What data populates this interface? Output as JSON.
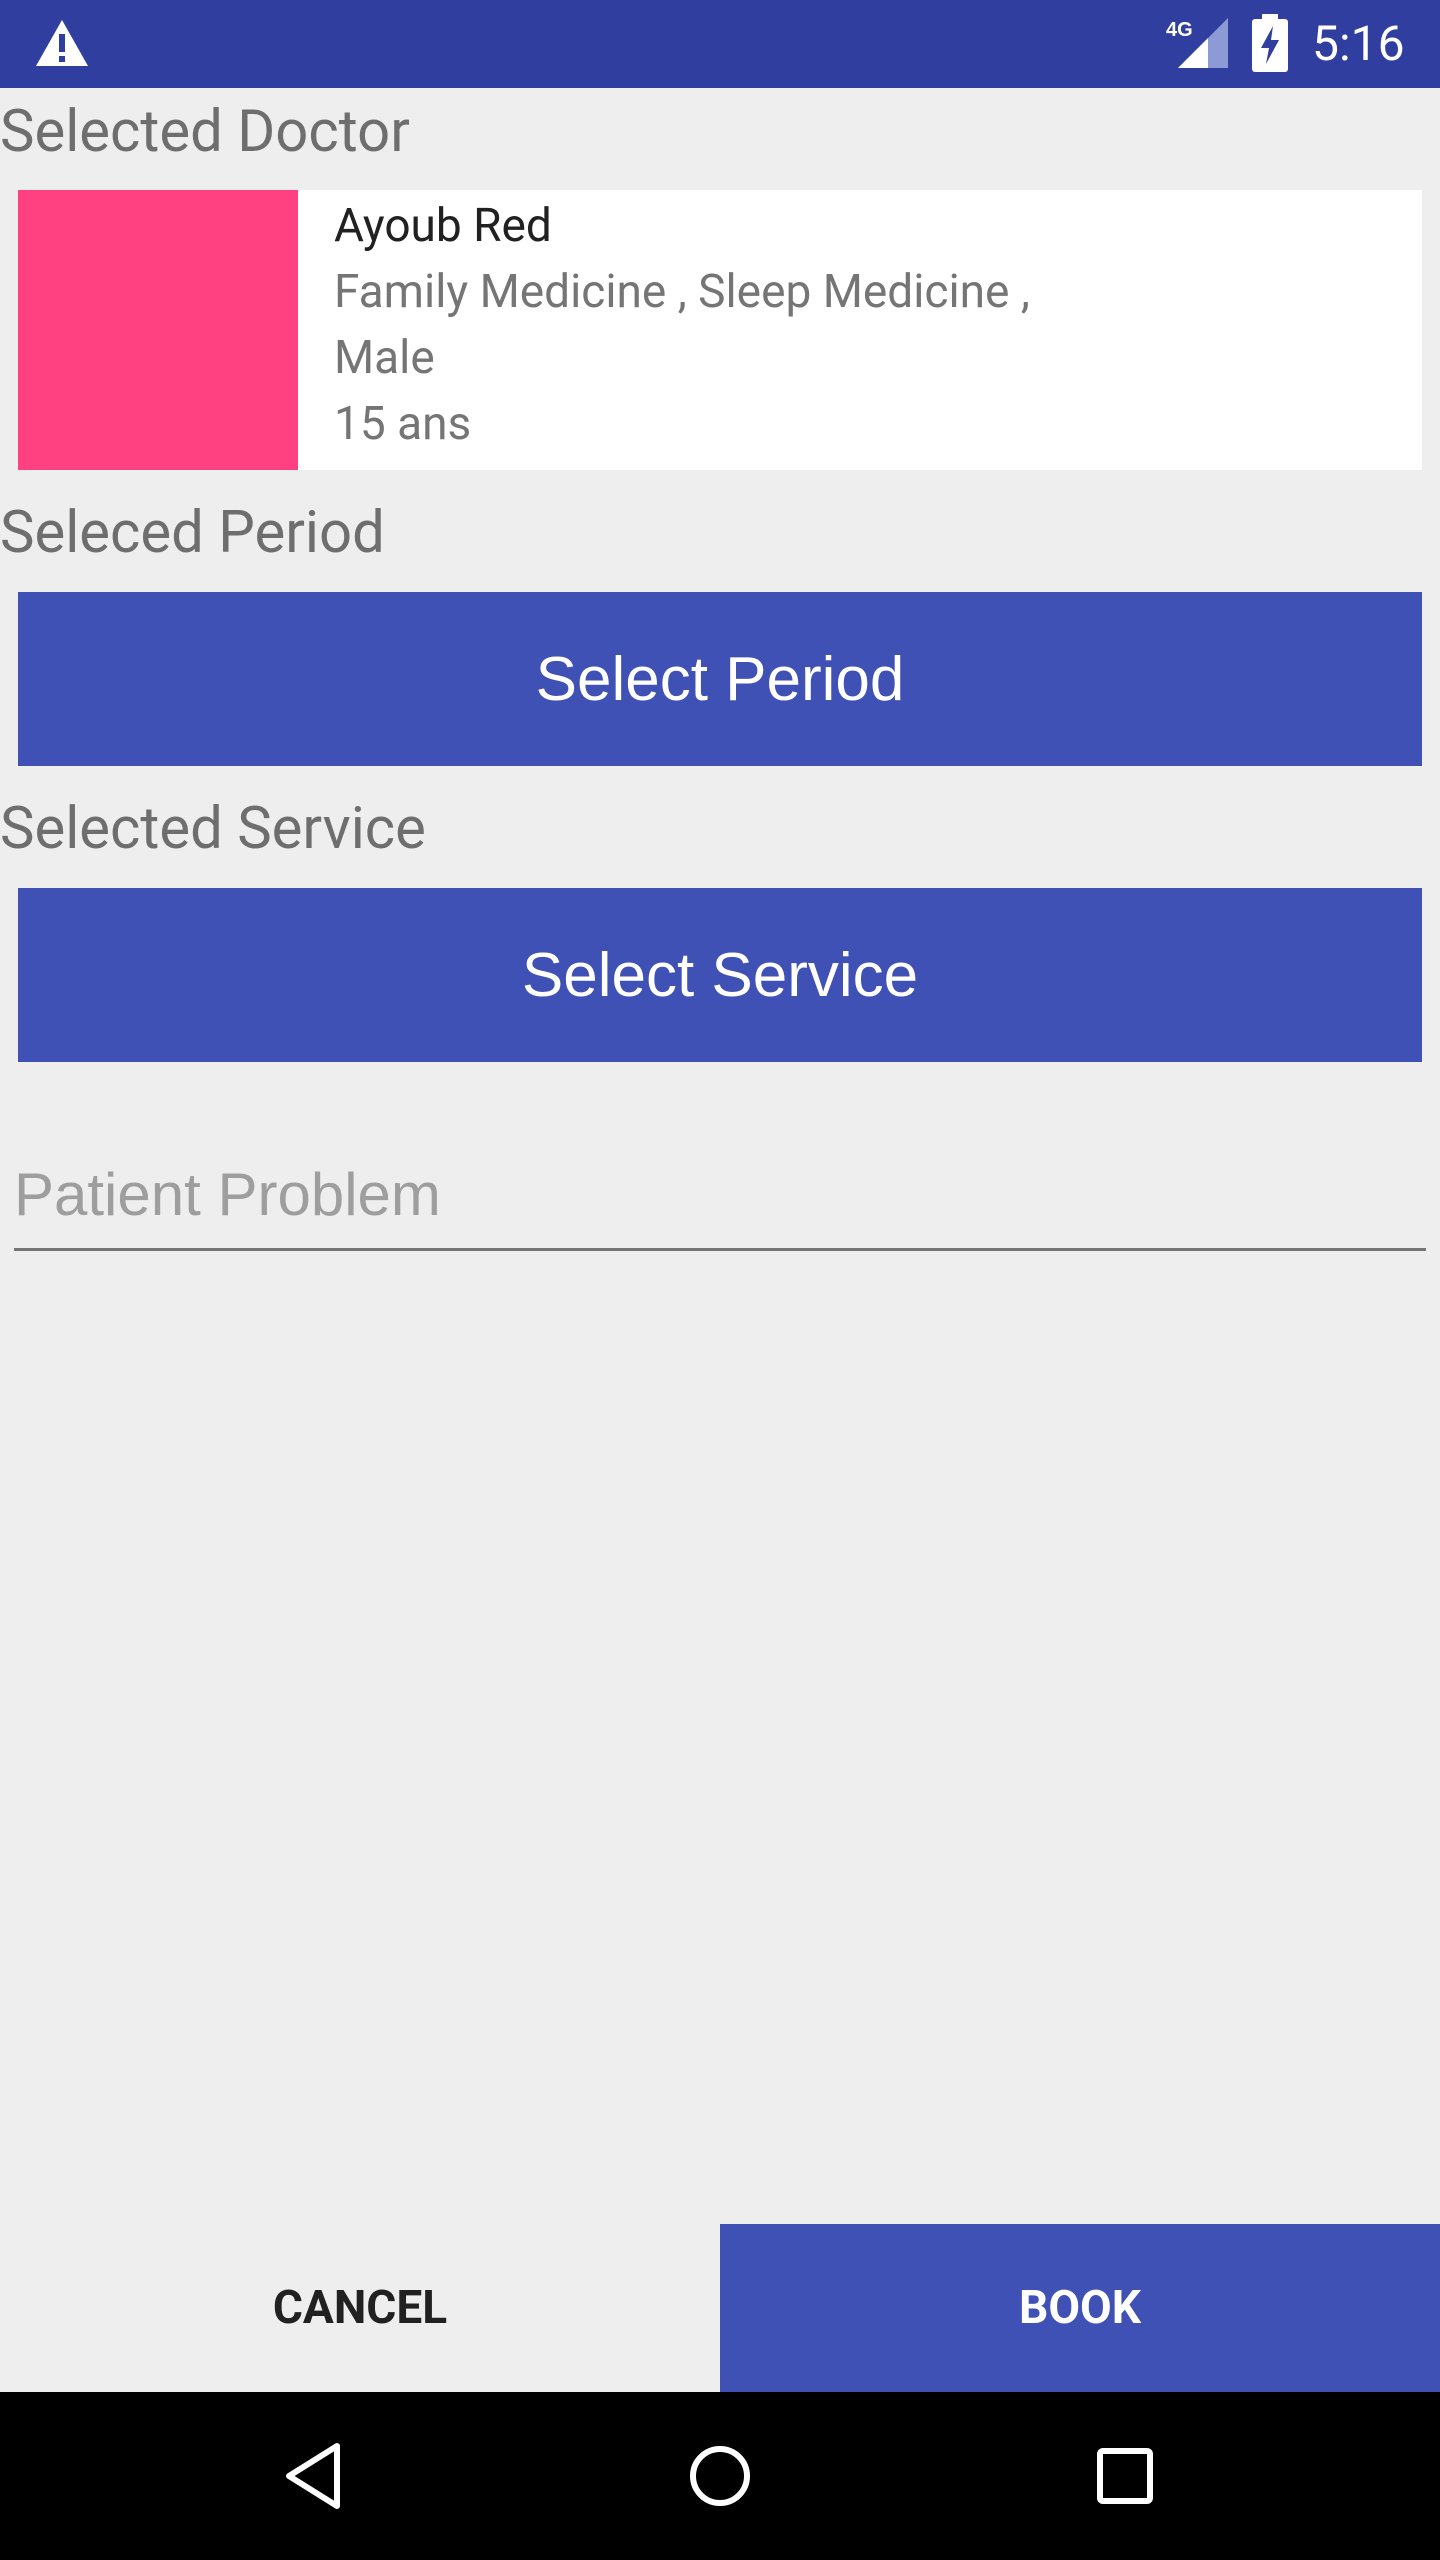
{
  "status_bar": {
    "time": "5:16",
    "network": "4G",
    "icons": [
      "warning-icon",
      "signal-icon",
      "battery-charging-icon"
    ]
  },
  "doctor_section": {
    "label": "Selected Doctor",
    "doctor": {
      "name": "Ayoub Red",
      "specialties": "Family Medicine , Sleep Medicine ,",
      "gender": "Male",
      "experience": "15 ans",
      "avatar_color": "#ff4081"
    }
  },
  "period_section": {
    "label": "Seleced Period",
    "button_label": "Select Period"
  },
  "service_section": {
    "label": "Selected Service",
    "button_label": "Select Service"
  },
  "problem_field": {
    "placeholder": "Patient Problem",
    "value": ""
  },
  "actions": {
    "cancel_label": "CANCEL",
    "book_label": "BOOK"
  },
  "nav_bar": {
    "icons": [
      "back-icon",
      "home-icon",
      "recents-icon"
    ]
  },
  "colors": {
    "primary": "#3f51b5",
    "primary_dark": "#303f9f",
    "accent": "#ff4081",
    "background": "#eeeeee"
  }
}
